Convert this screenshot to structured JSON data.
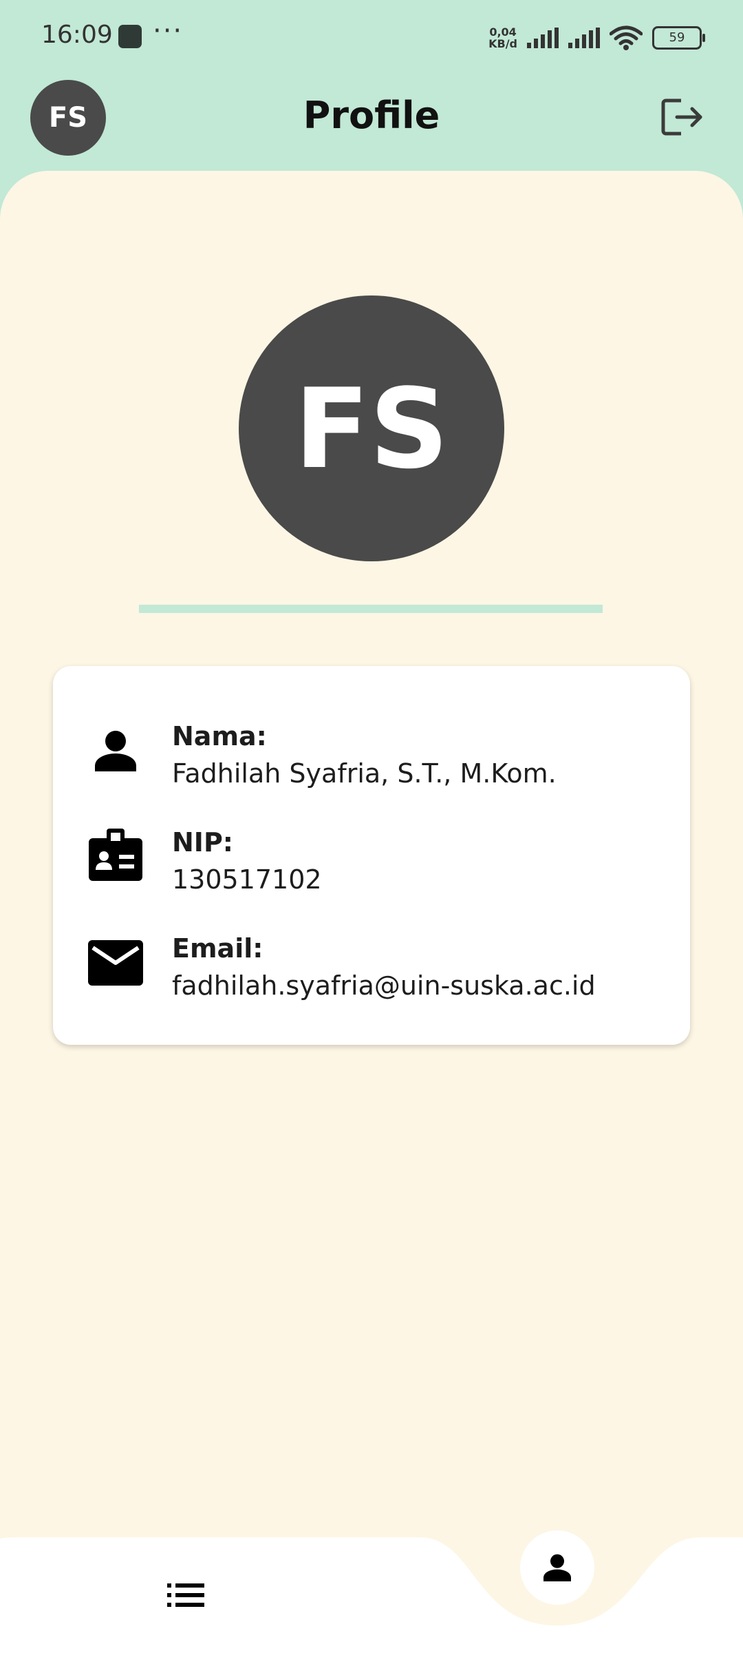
{
  "status_bar": {
    "time": "16:09",
    "more": "···",
    "net_speed_value": "0,04",
    "net_speed_unit": "KB/d",
    "battery": "59"
  },
  "app_bar": {
    "avatar_initials": "FS",
    "title": "Profile"
  },
  "profile": {
    "initials": "FS"
  },
  "info": {
    "name_label": "Nama:",
    "name_value": "Fadhilah Syafria, S.T., M.Kom.",
    "nip_label": "NIP:",
    "nip_value": "130517102",
    "email_label": "Email:",
    "email_value": "fadhilah.syafria@uin-suska.ac.id"
  },
  "icons": {
    "logout": "logout-icon",
    "person": "person-icon",
    "badge": "id-badge-icon",
    "email": "email-icon",
    "list": "list-icon",
    "profile_nav": "person-icon"
  },
  "colors": {
    "header_bg": "#c2e8d6",
    "sheet_bg": "#fdf6e4",
    "avatar_bg": "#4a4a4a",
    "card_bg": "#ffffff"
  }
}
